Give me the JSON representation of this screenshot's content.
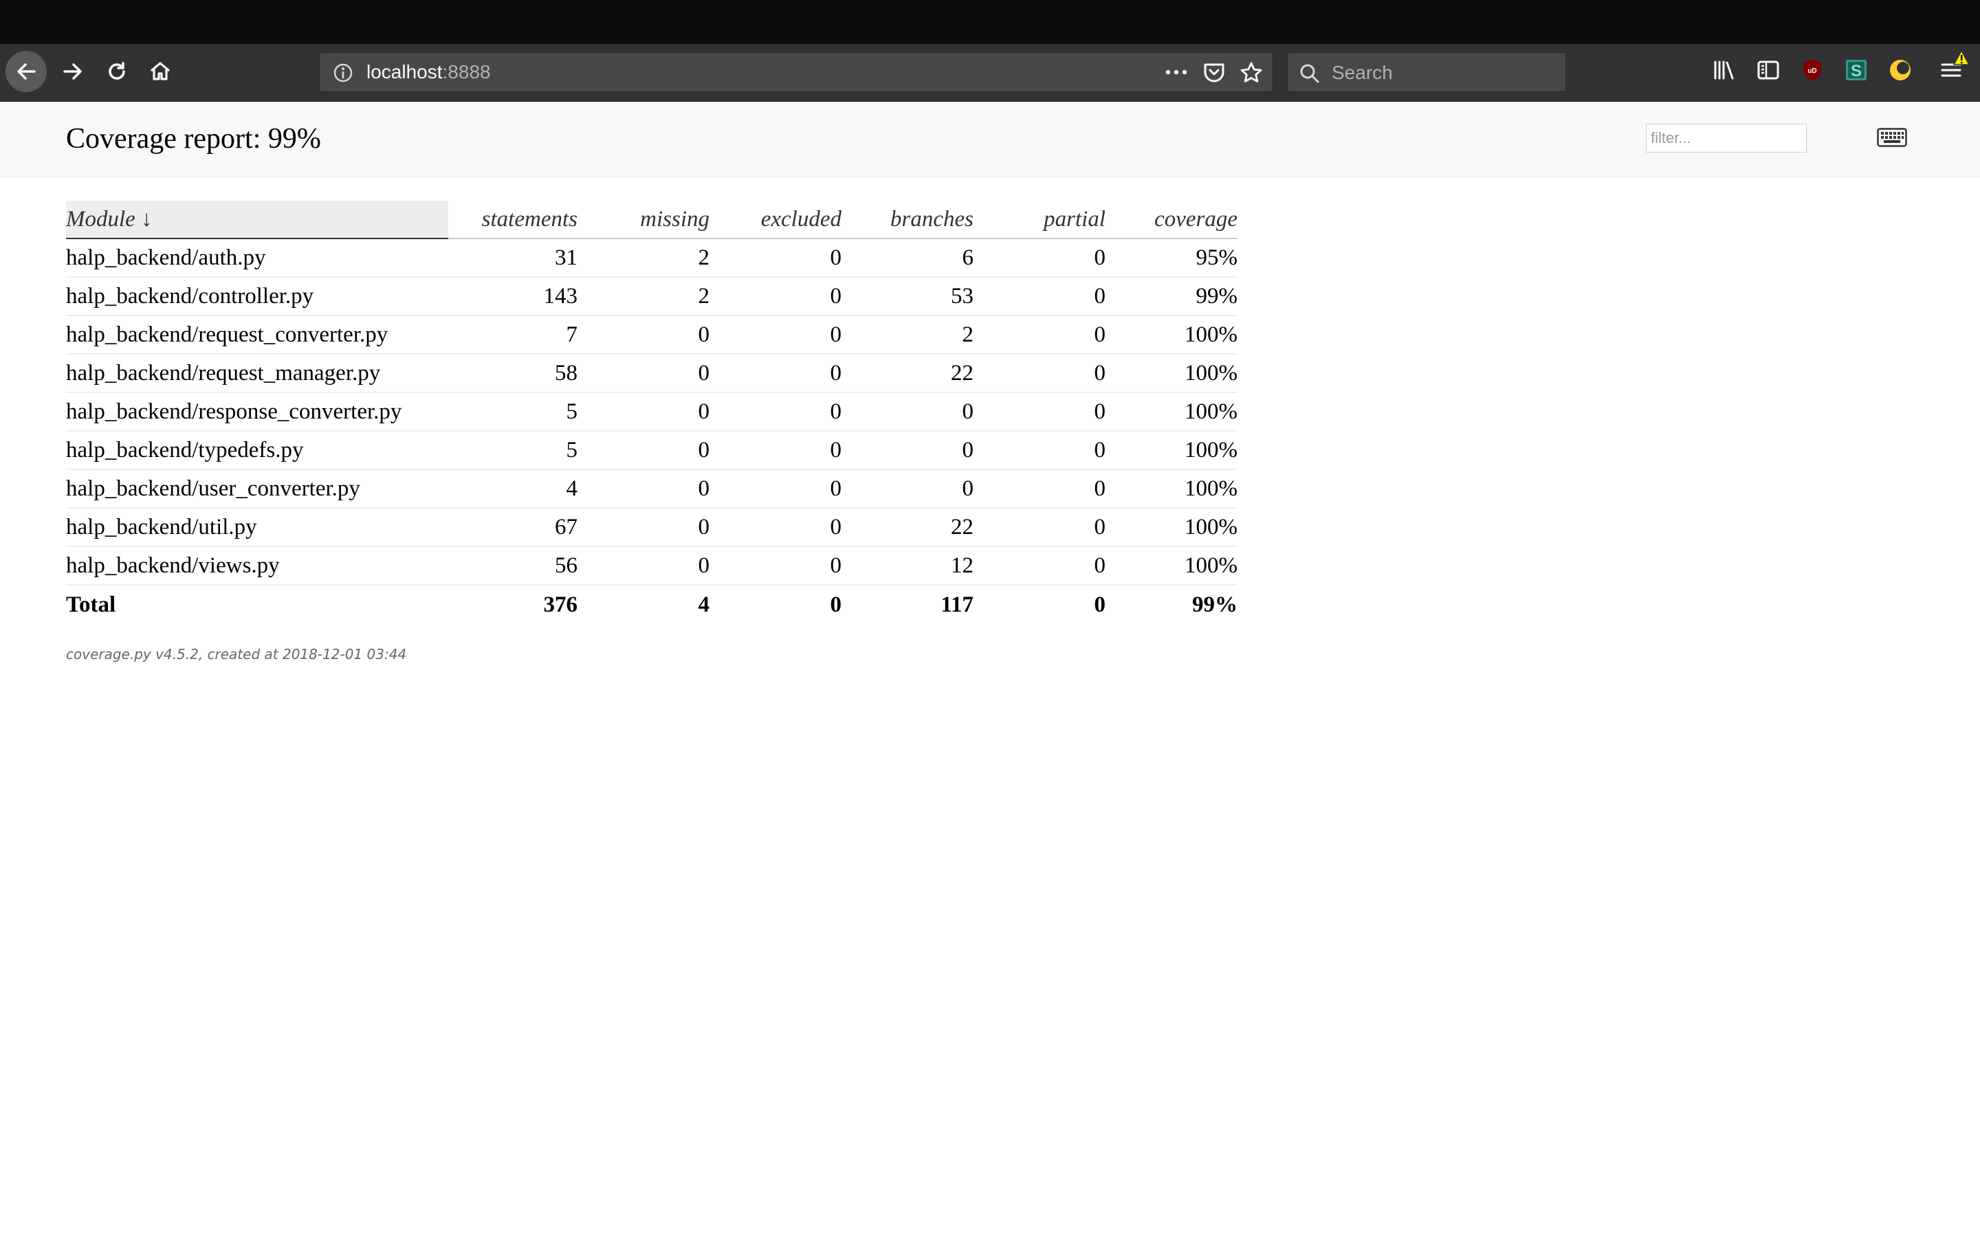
{
  "browser": {
    "url_host": "localhost",
    "url_port": ":8888",
    "search_placeholder": "Search"
  },
  "page": {
    "title": "Coverage report: 99%",
    "filter_placeholder": "filter..."
  },
  "table": {
    "headers": {
      "module": "Module ↓",
      "statements": "statements",
      "missing": "missing",
      "excluded": "excluded",
      "branches": "branches",
      "partial": "partial",
      "coverage": "coverage"
    },
    "rows": [
      {
        "name": "halp_backend/auth.py",
        "statements": "31",
        "missing": "2",
        "excluded": "0",
        "branches": "6",
        "partial": "0",
        "coverage": "95%"
      },
      {
        "name": "halp_backend/controller.py",
        "statements": "143",
        "missing": "2",
        "excluded": "0",
        "branches": "53",
        "partial": "0",
        "coverage": "99%"
      },
      {
        "name": "halp_backend/request_converter.py",
        "statements": "7",
        "missing": "0",
        "excluded": "0",
        "branches": "2",
        "partial": "0",
        "coverage": "100%"
      },
      {
        "name": "halp_backend/request_manager.py",
        "statements": "58",
        "missing": "0",
        "excluded": "0",
        "branches": "22",
        "partial": "0",
        "coverage": "100%"
      },
      {
        "name": "halp_backend/response_converter.py",
        "statements": "5",
        "missing": "0",
        "excluded": "0",
        "branches": "0",
        "partial": "0",
        "coverage": "100%"
      },
      {
        "name": "halp_backend/typedefs.py",
        "statements": "5",
        "missing": "0",
        "excluded": "0",
        "branches": "0",
        "partial": "0",
        "coverage": "100%"
      },
      {
        "name": "halp_backend/user_converter.py",
        "statements": "4",
        "missing": "0",
        "excluded": "0",
        "branches": "0",
        "partial": "0",
        "coverage": "100%"
      },
      {
        "name": "halp_backend/util.py",
        "statements": "67",
        "missing": "0",
        "excluded": "0",
        "branches": "22",
        "partial": "0",
        "coverage": "100%"
      },
      {
        "name": "halp_backend/views.py",
        "statements": "56",
        "missing": "0",
        "excluded": "0",
        "branches": "12",
        "partial": "0",
        "coverage": "100%"
      }
    ],
    "total": {
      "name": "Total",
      "statements": "376",
      "missing": "4",
      "excluded": "0",
      "branches": "117",
      "partial": "0",
      "coverage": "99%"
    }
  },
  "footer": {
    "text": "coverage.py v4.5.2, created at 2018-12-01 03:44"
  },
  "icons": {
    "back": "back-arrow-icon",
    "forward": "forward-arrow-icon",
    "reload": "reload-icon",
    "home": "home-icon",
    "info": "info-icon",
    "page_actions": "more-actions-icon",
    "pocket": "pocket-icon",
    "bookmark": "star-icon",
    "search": "search-icon",
    "library": "library-icon",
    "sidebar": "sidebar-icon",
    "ublock": "ublock-icon",
    "s_extension": "s-extension-icon",
    "dark_mode": "dark-mode-moon-icon",
    "menu": "hamburger-menu-icon",
    "warning": "warning-icon",
    "keyboard": "keyboard-icon"
  },
  "colors": {
    "toolbar_bg": "#323234",
    "header_bg": "#f8f8f8",
    "ublock_red": "#800000",
    "s_ext_teal": "#2f9a8a",
    "moon_yellow": "#ffcc33",
    "warning_yellow": "#ffe900"
  }
}
